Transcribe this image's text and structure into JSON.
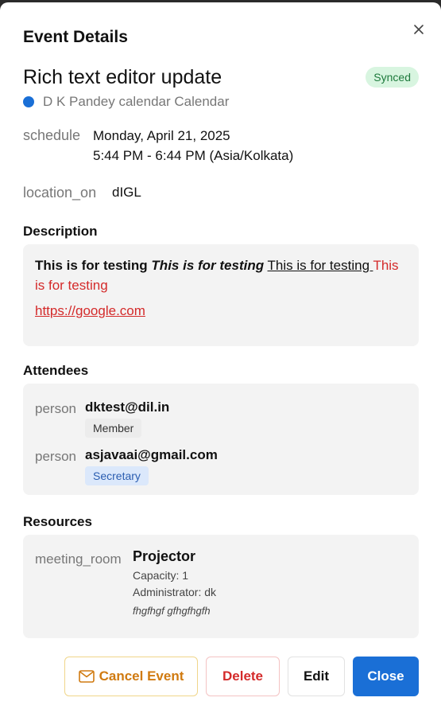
{
  "header": {
    "title": "Event Details"
  },
  "event": {
    "title": "Rich text editor update",
    "sync_status": "Synced",
    "calendar_name": "D K Pandey calendar Calendar",
    "calendar_color": "#1a6fd6"
  },
  "schedule": {
    "label": "schedule",
    "date": "Monday, April 21, 2025",
    "time": "5:44 PM - 6:44 PM (Asia/Kolkata)"
  },
  "location": {
    "label": "location_on",
    "value": "dIGL"
  },
  "description": {
    "heading": "Description",
    "bold_text": "This is for testing",
    "bold_italic_text": "This is for testing",
    "underline_text": "This is for testing ",
    "red_text": "This is for testing",
    "link": "https://google.com"
  },
  "attendees": {
    "heading": "Attendees",
    "items": [
      {
        "label": "person",
        "email": "dktest@dil.in",
        "role": "Member"
      },
      {
        "label": "person",
        "email": "asjavaai@gmail.com",
        "role": "Secretary"
      }
    ]
  },
  "resources": {
    "heading": "Resources",
    "items": [
      {
        "label": "meeting_room",
        "name": "Projector",
        "capacity": "Capacity: 1",
        "administrator": "Administrator: dk",
        "note": "fhgfhgf gfhgfhgfh"
      }
    ]
  },
  "actions": {
    "cancel_event": "Cancel Event",
    "delete": "Delete",
    "edit": "Edit",
    "close": "Close"
  },
  "colors": {
    "primary": "#1a6fd6",
    "danger": "#d42a2a",
    "warning": "#d07a10",
    "synced_bg": "#d8f5e0",
    "synced_text": "#1d7a3c"
  }
}
